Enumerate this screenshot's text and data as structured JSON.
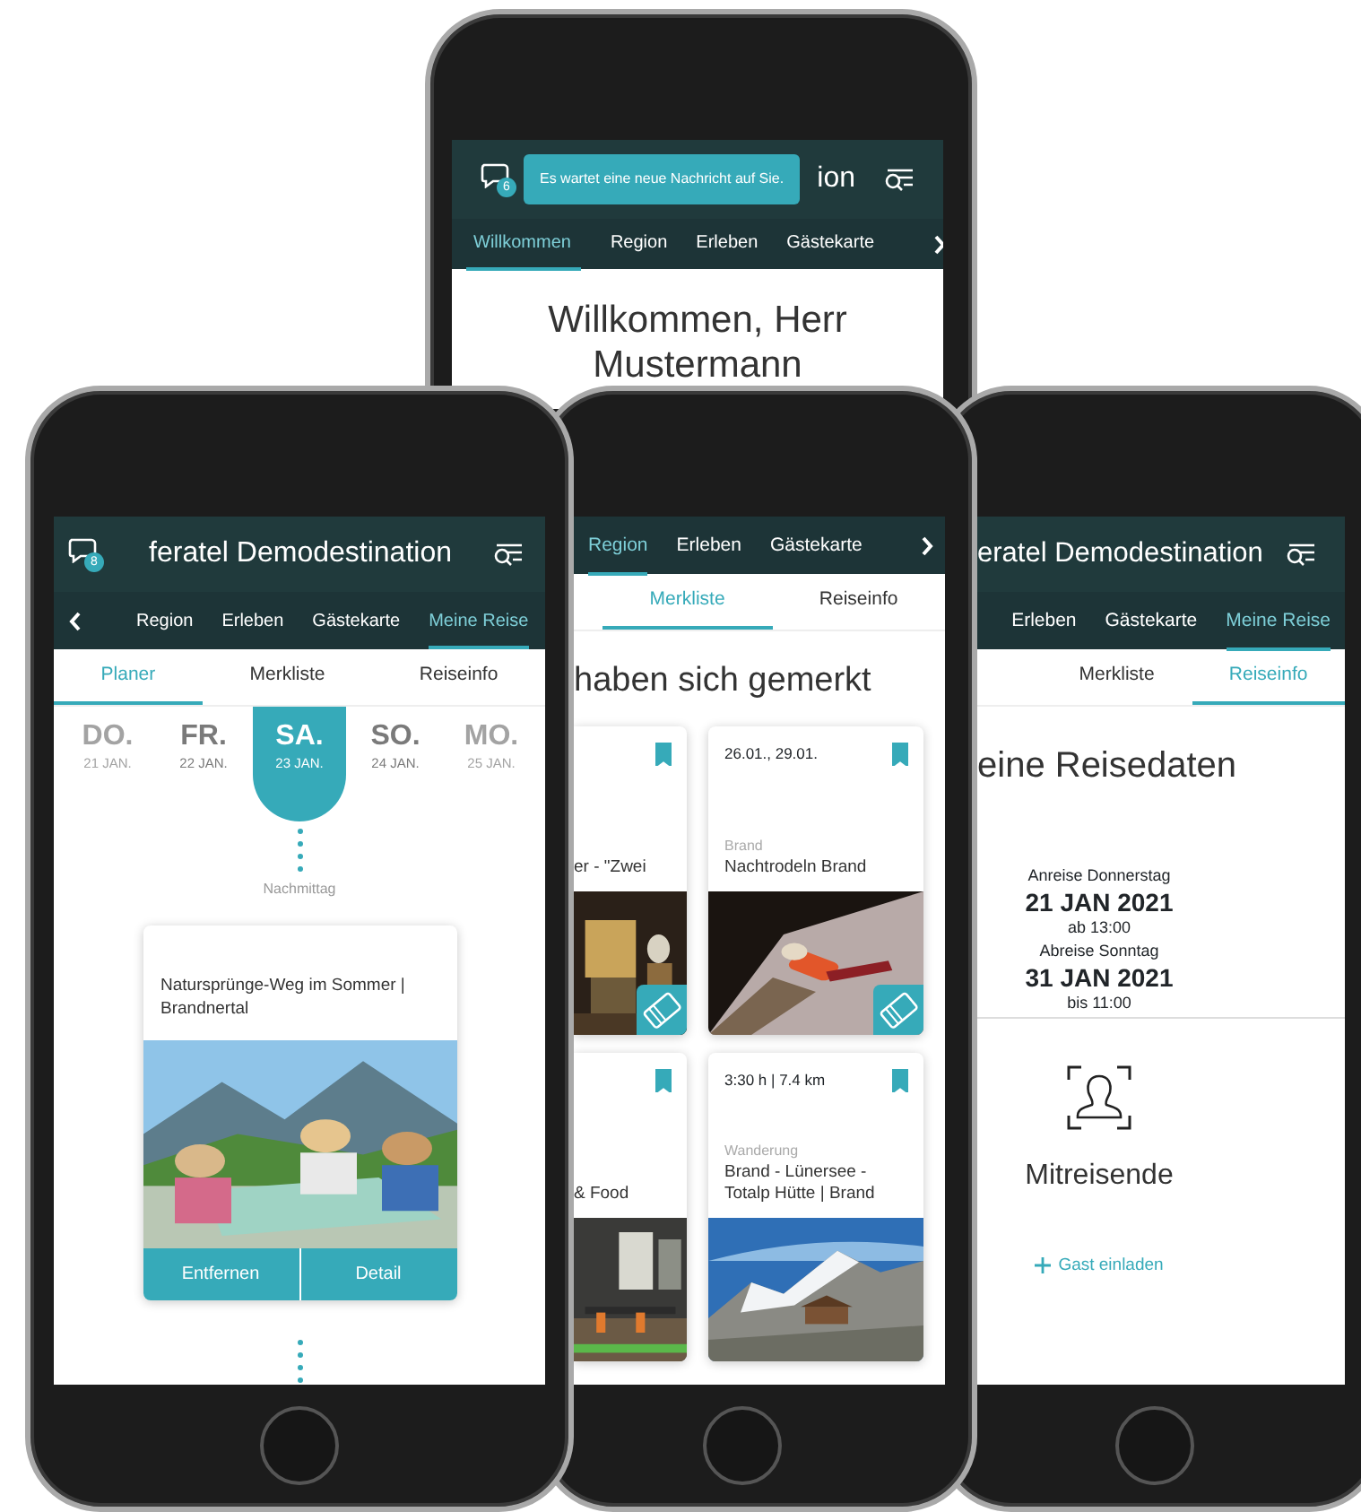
{
  "phones": [
    {
      "kind": "welcome",
      "badge": "6",
      "tooltip": "Es wartet eine neue Nachricht auf Sie.",
      "title": "ion",
      "tabs": [
        {
          "label": "Willkommen",
          "selected": true
        },
        {
          "label": "Region",
          "selected": false
        },
        {
          "label": "Erleben",
          "selected": false
        },
        {
          "label": "Gästekarte",
          "selected": false
        }
      ],
      "greeting": "Willkommen, Herr Mustermann"
    },
    {
      "kind": "planner",
      "badge": "8",
      "title": "feratel Demodestination",
      "tabs": [
        {
          "label": "Region",
          "selected": false
        },
        {
          "label": "Erleben",
          "selected": false
        },
        {
          "label": "Gästekarte",
          "selected": false
        },
        {
          "label": "Meine Reise",
          "selected": true
        }
      ],
      "subtabs": [
        {
          "label": "Planer",
          "selected": true
        },
        {
          "label": "Merkliste",
          "selected": false
        },
        {
          "label": "Reiseinfo",
          "selected": false
        }
      ],
      "days": [
        {
          "weekday": "DO.",
          "date": "21 JAN.",
          "selected": false,
          "muted": true
        },
        {
          "weekday": "FR.",
          "date": "22 JAN.",
          "selected": false,
          "muted": false
        },
        {
          "weekday": "SA.",
          "date": "23 JAN.",
          "selected": true,
          "muted": false
        },
        {
          "weekday": "SO.",
          "date": "24 JAN.",
          "selected": false,
          "muted": false
        },
        {
          "weekday": "MO.",
          "date": "25 JAN.",
          "selected": false,
          "muted": true
        }
      ],
      "slot": "Nachmittag",
      "card": {
        "title": "Natursprünge-Weg im Sommer | Brandnertal",
        "actions": [
          "Entfernen",
          "Detail"
        ]
      }
    },
    {
      "kind": "watchlist",
      "tabs": [
        {
          "label": "Region",
          "selected": true
        },
        {
          "label": "Erleben",
          "selected": false
        },
        {
          "label": "Gästekarte",
          "selected": false
        }
      ],
      "subtabs": [
        {
          "label": "Merkliste",
          "selected": true
        },
        {
          "label": "Reiseinfo",
          "selected": false
        }
      ],
      "heading": "haben sich gemerkt",
      "cards": [
        {
          "title": "er - \"Zwei",
          "bookmarked": true,
          "ticket": true
        },
        {
          "meta": "26.01., 29.01.",
          "category": "Brand",
          "title": "Nachtrodeln Brand",
          "bookmarked": true,
          "ticket": true
        },
        {
          "title": "& Food",
          "bookmarked": true,
          "ticket": false
        },
        {
          "meta": "3:30 h | 7.4 km",
          "category": "Wanderung",
          "title": "Brand - Lünersee - Totalp Hütte | Brand",
          "bookmarked": true,
          "ticket": false
        }
      ]
    },
    {
      "kind": "trip",
      "title": "eratel Demodestination",
      "tabs": [
        {
          "label": "Erleben",
          "selected": false
        },
        {
          "label": "Gästekarte",
          "selected": false
        },
        {
          "label": "Meine Reise",
          "selected": true
        }
      ],
      "subtabs": [
        {
          "label": "Merkliste",
          "selected": false
        },
        {
          "label": "Reiseinfo",
          "selected": true
        }
      ],
      "heading": "eine Reisedaten",
      "dates": [
        {
          "label": "Anreise Donnerstag",
          "date": "21 JAN 2021",
          "time": "ab 13:00"
        },
        {
          "label": "Abreise Sonntag",
          "date": "31 JAN 2021",
          "time": "bis 11:00"
        }
      ],
      "companions": "Mitreisende",
      "invite": "Gast einladen"
    }
  ]
}
